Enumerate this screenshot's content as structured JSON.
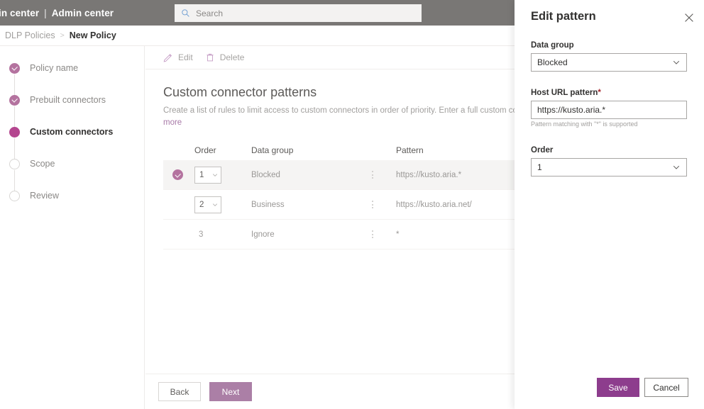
{
  "suite": {
    "brand_left": "in center",
    "brand_sep": "|",
    "brand_right": "Admin center",
    "search_placeholder": "Search",
    "search_value": "",
    "bar_color": "#797775"
  },
  "breadcrumb": {
    "parent": "DLP Policies",
    "separator": ">",
    "current": "New Policy"
  },
  "wizard": {
    "steps": [
      {
        "label": "Policy name",
        "state": "done"
      },
      {
        "label": "Prebuilt connectors",
        "state": "done"
      },
      {
        "label": "Custom connectors",
        "state": "active"
      },
      {
        "label": "Scope",
        "state": "todo"
      },
      {
        "label": "Review",
        "state": "todo"
      }
    ],
    "back_label": "Back",
    "next_label": "Next",
    "accent": "#b4468f",
    "next_color": "#ab7fa6"
  },
  "command_bar": {
    "edit_label": "Edit",
    "delete_label": "Delete"
  },
  "page": {
    "heading": "Custom connector patterns",
    "description": "Create a list of rules to limit access to custom connectors in order of priority. Enter a full custom connector U",
    "description_link": "more"
  },
  "table": {
    "headers": {
      "order": "Order",
      "data_group": "Data group",
      "pattern": "Pattern"
    },
    "rows": [
      {
        "order": "1",
        "order_type": "dropdown",
        "data_group": "Blocked",
        "pattern": "https://kusto.aria.*",
        "selected": true
      },
      {
        "order": "2",
        "order_type": "dropdown",
        "data_group": "Business",
        "pattern": "https://kusto.aria.net/",
        "selected": false
      },
      {
        "order": "3",
        "order_type": "plain",
        "data_group": "Ignore",
        "pattern": "*",
        "selected": false
      }
    ]
  },
  "panel": {
    "title": "Edit pattern",
    "data_group_label": "Data group",
    "data_group_value": "Blocked",
    "host_url_label": "Host URL pattern",
    "host_url_required": "*",
    "host_url_value": "https://kusto.aria.*",
    "host_url_help": "Pattern matching with \"*\" is supported",
    "order_label": "Order",
    "order_value": "1",
    "save_label": "Save",
    "cancel_label": "Cancel",
    "save_color": "#8d3d8d"
  }
}
